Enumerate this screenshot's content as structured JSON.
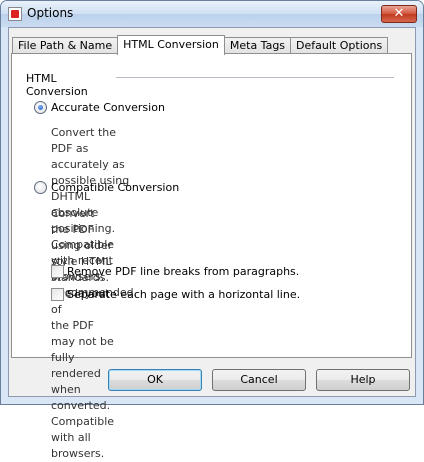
{
  "window": {
    "title": "Options",
    "close_glyph": "✕",
    "app_icon": "options-app-icon"
  },
  "tabs": [
    {
      "label": "File Path & Name",
      "active": false
    },
    {
      "label": "HTML Conversion",
      "active": true
    },
    {
      "label": "Meta Tags",
      "active": false
    },
    {
      "label": "Default Options",
      "active": false
    }
  ],
  "group": {
    "label": "HTML Conversion",
    "accurate": {
      "label": "Accurate Conversion",
      "selected": true,
      "description_lines": [
        "Convert the PDF as accurately as possible using DHTML absolute",
        "positioning. Compatible with recent browsers. Recommended."
      ]
    },
    "compatible": {
      "label": "Compatible Conversion",
      "selected": false,
      "description_lines": [
        "Convert the PDF using older style HTML standards. The layout of",
        "the PDF may not be fully rendered when converted. Compatible",
        "with all browsers."
      ]
    },
    "remove_line_breaks": {
      "label": "Remove PDF line breaks from paragraphs.",
      "checked": false
    },
    "separate_pages": {
      "label": "Separate each page with a horizontal line.",
      "checked": false
    }
  },
  "buttons": {
    "ok": "OK",
    "cancel": "Cancel",
    "help": "Help"
  }
}
